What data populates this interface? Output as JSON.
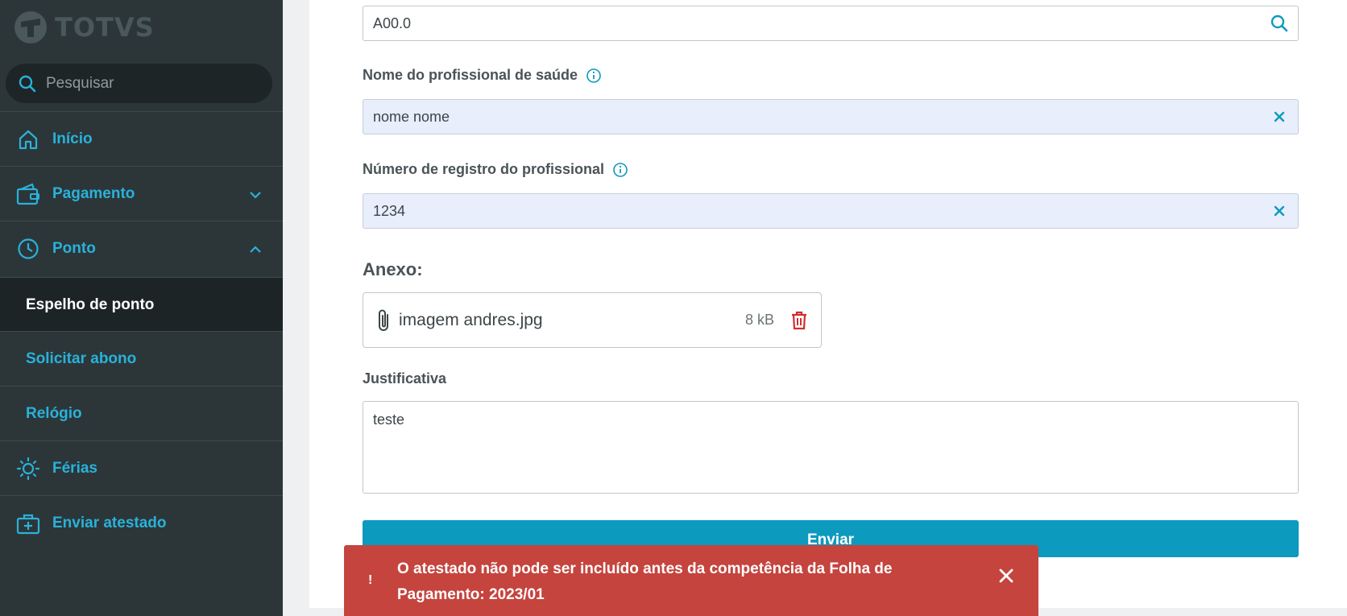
{
  "app": {
    "logo_text": "TOTVS"
  },
  "sidebar": {
    "search_placeholder": "Pesquisar",
    "items": [
      {
        "label": "Início",
        "icon": "home-icon"
      },
      {
        "label": "Pagamento",
        "icon": "wallet-icon",
        "chevron": "chevron-down-icon"
      },
      {
        "label": "Ponto",
        "icon": "clock-icon",
        "chevron": "chevron-up-icon"
      },
      {
        "label": "Espelho de ponto",
        "active": true
      },
      {
        "label": "Solicitar abono"
      },
      {
        "label": "Relógio"
      },
      {
        "label": "Férias",
        "icon": "sun-icon"
      },
      {
        "label": "Enviar atestado",
        "icon": "medical-bag-icon"
      }
    ]
  },
  "form": {
    "cid_value": "A00.0",
    "professional_name_label": "Nome do profissional de saúde",
    "professional_name_value": "nome nome",
    "registration_label": "Número de registro do profissional",
    "registration_value": "1234",
    "attachment_title": "Anexo:",
    "attachment": {
      "file_name": "imagem andres.jpg",
      "file_size": "8 kB"
    },
    "justification_label": "Justificativa",
    "justification_value": "teste",
    "submit_label": "Enviar"
  },
  "toast": {
    "icon": "!",
    "message": "O atestado não pode ser incluído antes da competência da Folha de Pagamento: 2023/01"
  },
  "colors": {
    "sidebar_bg": "#2c3639",
    "accent": "#0c9abe",
    "nav_link": "#29b2d9",
    "error": "#c5443e",
    "delete": "#d22e2e"
  }
}
